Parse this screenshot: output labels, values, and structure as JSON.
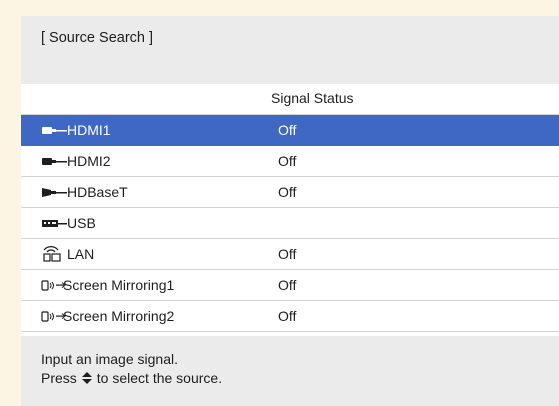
{
  "title": "[ Source Search ]",
  "column_header": "Signal Status",
  "sources": [
    {
      "name": "HDMI1",
      "status": "Off",
      "icon": "hdmi-icon",
      "selected": true
    },
    {
      "name": "HDMI2",
      "status": "Off",
      "icon": "hdmi-icon",
      "selected": false
    },
    {
      "name": "HDBaseT",
      "status": "Off",
      "icon": "hdbaset-icon",
      "selected": false
    },
    {
      "name": "USB",
      "status": "",
      "icon": "usb-icon",
      "selected": false
    },
    {
      "name": "LAN",
      "status": "Off",
      "icon": "lan-icon",
      "selected": false
    },
    {
      "name": "Screen Mirroring1",
      "status": "Off",
      "icon": "screen-mirroring-icon",
      "selected": false
    },
    {
      "name": "Screen Mirroring2",
      "status": "Off",
      "icon": "screen-mirroring-icon",
      "selected": false
    }
  ],
  "help": {
    "line1": "Input an image signal.",
    "line2_prefix": "Press",
    "line2_icon": "up-down-arrows-icon",
    "line2_suffix": "to select the source."
  },
  "colors": {
    "background": "#fdf5e4",
    "panel": "#ebebeb",
    "list": "#ffffff",
    "selected": "#3f68c4"
  }
}
